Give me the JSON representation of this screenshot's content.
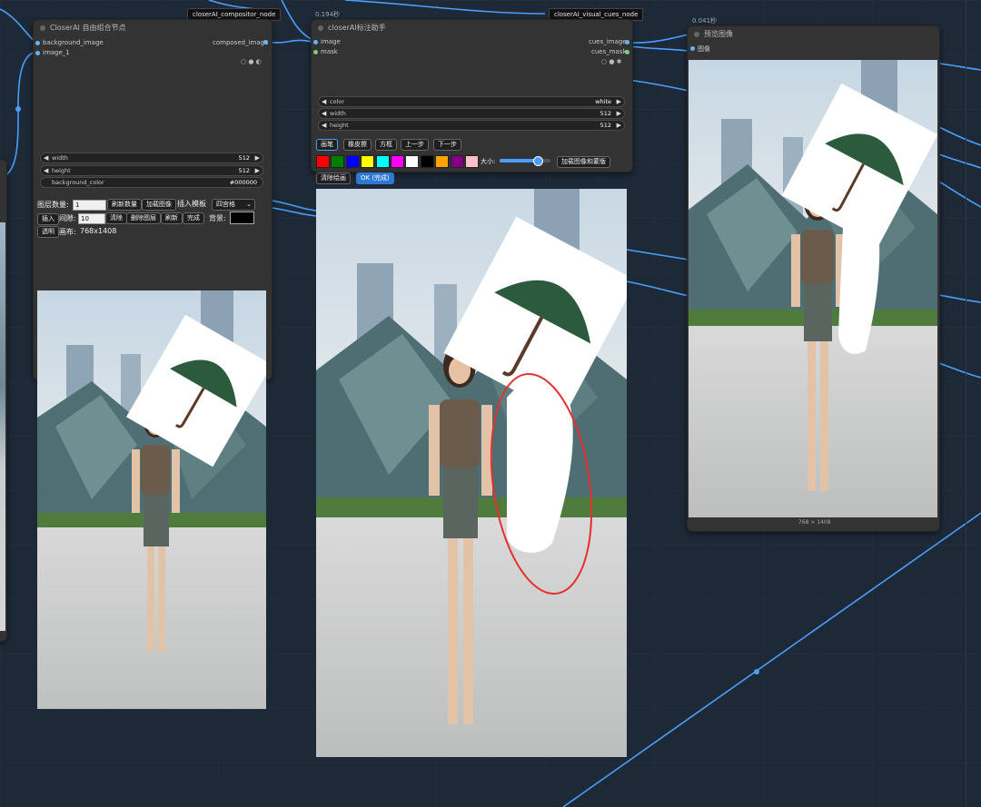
{
  "canvas": {
    "bg": "#1d2937",
    "wire_color": "#4a9eff"
  },
  "compositor": {
    "badge": "closerAI_compositor_node",
    "title": "CloserAI 自由组合节点",
    "inputs": [
      "background_image",
      "image_1"
    ],
    "output": "composed_image",
    "width_label": "width",
    "width_value": "512",
    "height_label": "height",
    "height_value": "512",
    "bgcolor_label": "background_color",
    "bgcolor_value": "#000000",
    "layer_count_label": "图层数量:",
    "layer_count_value": "1",
    "refresh_count": "刷新数量",
    "load_image": "加载图像",
    "insert_template_label": "插入模板",
    "template_value": "四宫格",
    "insert": "插入",
    "spacing_label": "间隙:",
    "spacing_value": "10",
    "clear": "清除",
    "delete_layer": "删除图层",
    "refresh": "刷新",
    "done": "完成",
    "bg_label": "背景:",
    "transparent": "透明",
    "canvas_label": "画布:",
    "canvas_size": "768x1408"
  },
  "cues": {
    "badge": "closerAI_visual_cues_node",
    "timing": "0.194秒",
    "title": "closerAI标注助手",
    "inputs": [
      "image",
      "mask"
    ],
    "outputs": [
      "cues_image",
      "cues_mask"
    ],
    "color_label": "color",
    "color_value": "white",
    "width_label": "width",
    "width_value": "512",
    "height_label": "height",
    "height_value": "512",
    "tools": [
      "画笔",
      "橡皮擦",
      "方框",
      "上一步",
      "下一步"
    ],
    "palette": [
      "#ff0000",
      "#008000",
      "#0000ff",
      "#ffff00",
      "#00ffff",
      "#ff00ff",
      "#ffffff",
      "#000000",
      "#ffa500",
      "#800080",
      "#ffc0cb"
    ],
    "size_label": "大小:",
    "size_fraction": 0.75,
    "load_mask": "加载图像和蒙版",
    "clear_drawing": "清除绘画",
    "ok": "OK (完成)"
  },
  "preview": {
    "timing": "0.041秒",
    "title": "预览图像",
    "input": "图像",
    "caption": "768 × 1408"
  }
}
